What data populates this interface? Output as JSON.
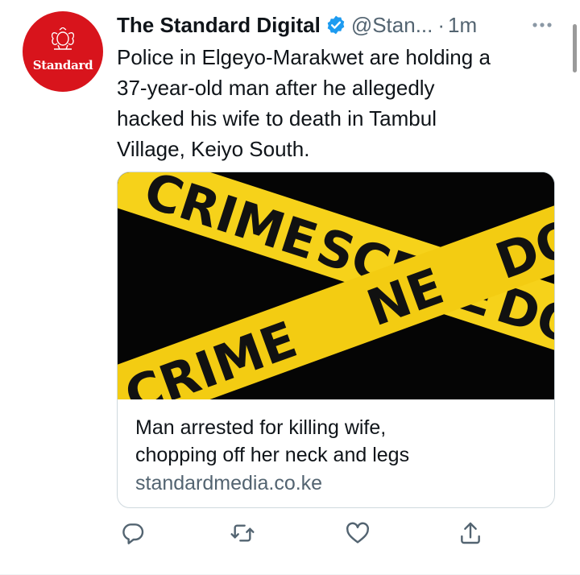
{
  "tweet": {
    "author": {
      "display_name": "The Standard Digital",
      "handle": "@Stan...",
      "verified": true,
      "avatar_text": "Standard",
      "avatar_color": "#d8141c"
    },
    "separator": "·",
    "time": "1m",
    "text_lines": [
      "Police in Elgeyo-Marakwet are holding a",
      "37-year-old man after he allegedly",
      "hacked his wife to death in Tambul",
      "Village, Keiyo South."
    ],
    "card": {
      "image_icon": "crime-scene-tape-image",
      "image_words": {
        "crime_top": "CRIME",
        "scene": "SCENE",
        "do_top": "DO",
        "crime_bottom": "CRIME",
        "do_bottom": "DO",
        "partial_ne": "NE"
      },
      "title_lines": [
        "Man arrested for killing wife,",
        "chopping off her neck and legs"
      ],
      "domain": "standardmedia.co.ke"
    },
    "actions": {
      "reply_icon": "reply-icon",
      "retweet_icon": "retweet-icon",
      "like_icon": "heart-icon",
      "share_icon": "share-icon"
    }
  },
  "colors": {
    "verified_blue": "#1d9bf0",
    "secondary_text": "#536471",
    "tape_yellow": "#f6d21a",
    "tape_text": "#111111"
  }
}
